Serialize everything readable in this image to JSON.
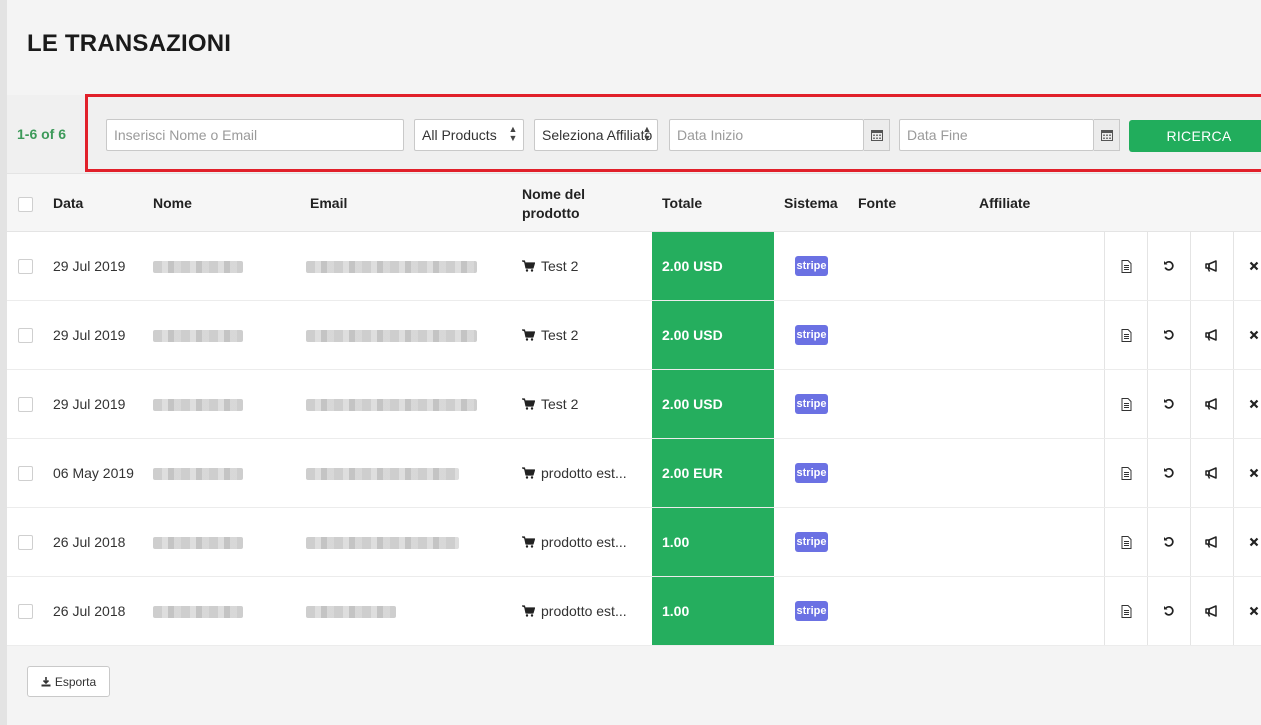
{
  "page": {
    "title": "LE TRANSAZIONI"
  },
  "filters": {
    "counter": "1-6 of 6",
    "search_placeholder": "Inserisci Nome o Email",
    "product_select": "All Products",
    "affiliate_select": "Seleziona Affiliato",
    "start_date_placeholder": "Data Inizio",
    "end_date_placeholder": "Data Fine",
    "search_button": "RICERCA"
  },
  "table": {
    "headers": {
      "date": "Data",
      "name": "Nome",
      "email": "Email",
      "product": "Nome del prodotto",
      "total": "Totale",
      "system": "Sistema",
      "source": "Fonte",
      "affiliate": "Affiliate"
    },
    "rows": [
      {
        "date": "29 Jul 2019",
        "product": "Test 2",
        "total": "2.00 USD",
        "system": "stripe"
      },
      {
        "date": "29 Jul 2019",
        "product": "Test 2",
        "total": "2.00 USD",
        "system": "stripe"
      },
      {
        "date": "29 Jul 2019",
        "product": "Test 2",
        "total": "2.00 USD",
        "system": "stripe"
      },
      {
        "date": "06 May 2019",
        "product": "prodotto est...",
        "total": "2.00 EUR",
        "system": "stripe"
      },
      {
        "date": "26 Jul 2018",
        "product": "prodotto est...",
        "total": "1.00",
        "system": "stripe"
      },
      {
        "date": "26 Jul 2018",
        "product": "prodotto est...",
        "total": "1.00",
        "system": "stripe"
      }
    ]
  },
  "footer": {
    "export_label": "Esporta"
  },
  "colors": {
    "accent_green": "#21ad5c",
    "stripe_purple": "#6b71e3",
    "highlight_red": "#e1202a"
  },
  "icons": [
    "calendar-icon",
    "cart-icon",
    "invoice-icon",
    "refund-icon",
    "megaphone-icon",
    "close-icon",
    "download-icon"
  ]
}
